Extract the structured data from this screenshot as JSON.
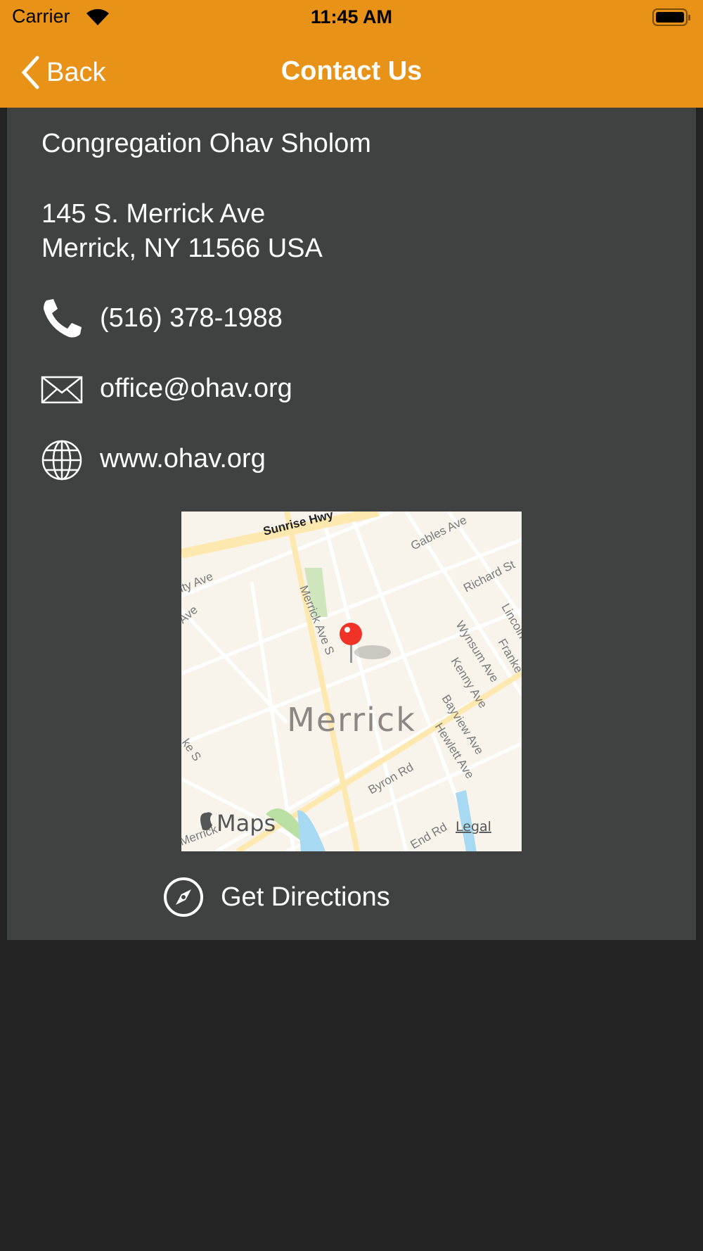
{
  "status_bar": {
    "carrier": "Carrier",
    "time": "11:45 AM"
  },
  "nav": {
    "back_label": "Back",
    "title": "Contact Us"
  },
  "contact": {
    "name": "Congregation Ohav Sholom",
    "address_line1": "145 S. Merrick Ave",
    "address_line2": "Merrick, NY 11566 USA",
    "phone": "(516) 378-1988",
    "email": "office@ohav.org",
    "website": "www.ohav.org"
  },
  "map": {
    "place": "Merrick",
    "attribution": "Maps",
    "legal": "Legal",
    "streets": [
      "Sunrise Hwy",
      "Gables Ave",
      "Richard St",
      "Merrick Ave S",
      "Wynsum Ave",
      "Kenny Ave",
      "Bayview Ave",
      "Hewlett Ave",
      "Byron Rd",
      "End Rd",
      "Lincoln",
      "Franke",
      "ity Ave",
      "Ave",
      "ke S",
      "Merrick"
    ]
  },
  "directions_label": "Get Directions",
  "colors": {
    "accent": "#e89217",
    "card": "#404141",
    "background": "#232323"
  }
}
